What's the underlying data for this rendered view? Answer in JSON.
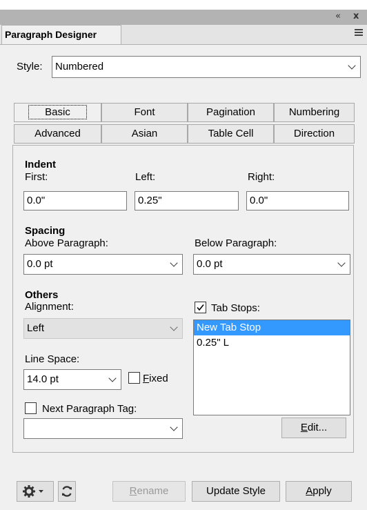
{
  "window": {
    "panel_title": "Paragraph Designer",
    "collapse_glyph": "«",
    "close_glyph": "x"
  },
  "style": {
    "label": "Style:",
    "value": "Numbered"
  },
  "tabs": [
    {
      "label": "Basic"
    },
    {
      "label": "Font"
    },
    {
      "label": "Pagination"
    },
    {
      "label": "Numbering"
    },
    {
      "label": "Advanced"
    },
    {
      "label": "Asian"
    },
    {
      "label": "Table Cell"
    },
    {
      "label": "Direction"
    }
  ],
  "indent": {
    "heading": "Indent",
    "first_label": "First:",
    "first_value": "0.0\"",
    "left_label": "Left:",
    "left_value": "0.25\"",
    "right_label": "Right:",
    "right_value": "0.0\""
  },
  "spacing": {
    "heading": "Spacing",
    "above_label": "Above Paragraph:",
    "above_value": "0.0 pt",
    "below_label": "Below Paragraph:",
    "below_value": "0.0 pt"
  },
  "others": {
    "heading": "Others",
    "alignment_label": "Alignment:",
    "alignment_value": "Left",
    "line_space_label": "Line Space:",
    "line_space_value": "14.0 pt",
    "fixed_label_u": "F",
    "fixed_label_rest": "ixed",
    "fixed_checked": false,
    "next_tag_label": "Next Paragraph Tag:",
    "next_tag_checked": false,
    "next_tag_value": ""
  },
  "tab_stops": {
    "label": "Tab Stops:",
    "checked": true,
    "items": [
      "New Tab Stop",
      "0.25\"  L"
    ],
    "edit_u": "E",
    "edit_rest": "dit..."
  },
  "bottom": {
    "rename_u": "R",
    "rename_rest": "ename",
    "update_label": "Update Style",
    "apply_u": "A",
    "apply_rest": "pply"
  },
  "colors": {
    "selection": "#3399ff",
    "title_bar": "#b3b3b3",
    "panel_bg": "#f0f0f0"
  }
}
